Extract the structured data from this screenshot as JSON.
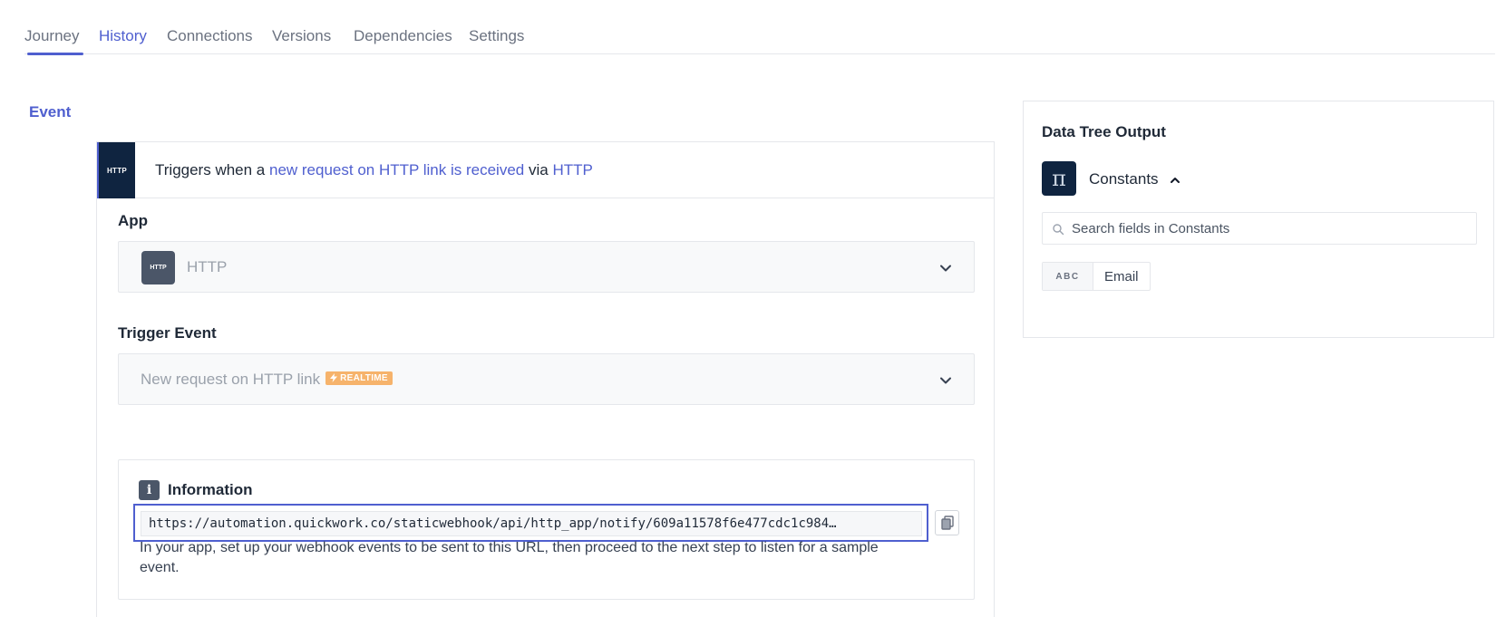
{
  "tabs": [
    {
      "label": "Journey"
    },
    {
      "label": "History"
    },
    {
      "label": "Connections"
    },
    {
      "label": "Versions"
    },
    {
      "label": "Dependencies"
    },
    {
      "label": "Settings"
    }
  ],
  "active_tab": "Journey",
  "event_label": "Event",
  "trigger": {
    "badge": "HTTP",
    "prefix": "Triggers when a ",
    "event_link": "new request on HTTP link is received",
    "middle": " via ",
    "app_link": "HTTP"
  },
  "app_section": {
    "label": "App",
    "icon_text": "HTTP",
    "value": "HTTP"
  },
  "trigger_event_section": {
    "label": "Trigger Event",
    "value": "New request on HTTP link",
    "badge": "REALTIME"
  },
  "information": {
    "icon": "i",
    "title": "Information",
    "url": "https://automation.quickwork.co/staticwebhook/api/http_app/notify/609a11578f6e477cdc1c984…",
    "description": "In your app, set up your webhook events to be sent to this URL, then proceed to the next step to listen for a sample event."
  },
  "data_tree": {
    "title": "Data Tree Output",
    "icon_glyph": "π",
    "group_label": "Constants",
    "search_placeholder": "Search fields in Constants",
    "fields": [
      {
        "type": "ABC",
        "name": "Email"
      }
    ]
  },
  "colors": {
    "accent": "#4f5fcf",
    "navy": "#0f2440",
    "realtime": "#f6b36b"
  }
}
